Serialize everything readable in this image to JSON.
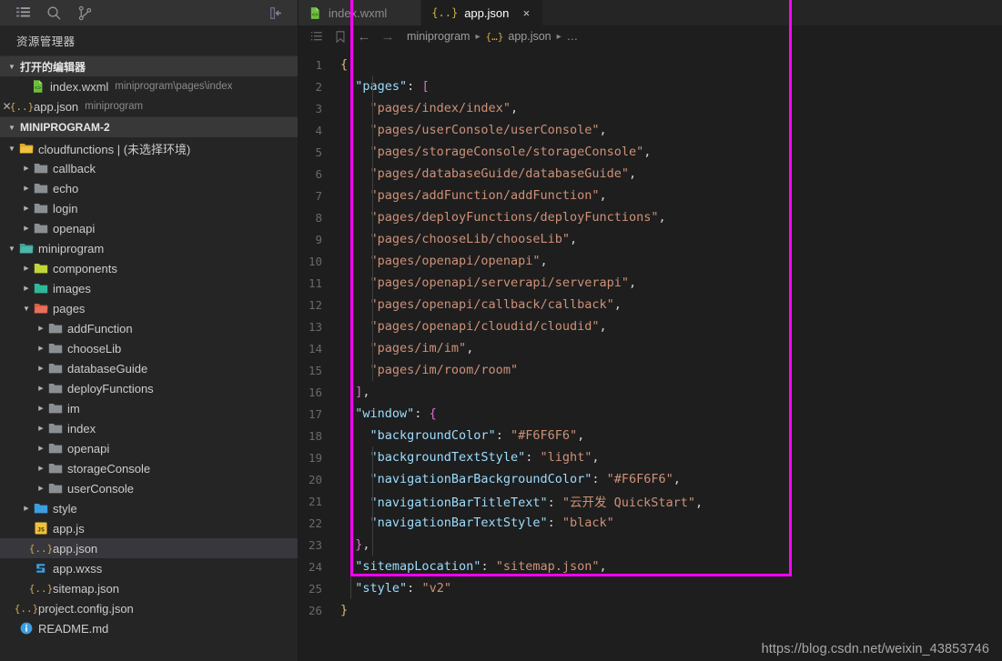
{
  "activity_bar": {
    "icons": [
      "explorer-icon",
      "search-icon",
      "source-control-icon"
    ],
    "collapse_label": "collapse-sidebar-icon"
  },
  "sidebar": {
    "title": "资源管理器",
    "open_editors": {
      "header": "打开的编辑器",
      "items": [
        {
          "name": "index.wxml",
          "desc": "miniprogram\\pages\\index",
          "icon": "wxml-file-icon",
          "selected": false,
          "show_close": false
        },
        {
          "name": "app.json",
          "desc": "miniprogram",
          "icon": "json-file-icon",
          "selected": false,
          "show_close": true
        }
      ]
    },
    "project": {
      "header": "MINIPROGRAM-2",
      "tree": [
        {
          "label": "cloudfunctions | (未选择环境)",
          "depth": 1,
          "type": "folder",
          "state": "open",
          "icon": "folder-yellow-icon",
          "selected": false
        },
        {
          "label": "callback",
          "depth": 2,
          "type": "folder",
          "state": "closed",
          "icon": "folder-gray-icon",
          "selected": false
        },
        {
          "label": "echo",
          "depth": 2,
          "type": "folder",
          "state": "closed",
          "icon": "folder-gray-icon",
          "selected": false
        },
        {
          "label": "login",
          "depth": 2,
          "type": "folder",
          "state": "closed",
          "icon": "folder-gray-icon",
          "selected": false
        },
        {
          "label": "openapi",
          "depth": 2,
          "type": "folder",
          "state": "closed",
          "icon": "folder-gray-icon",
          "selected": false
        },
        {
          "label": "miniprogram",
          "depth": 1,
          "type": "folder",
          "state": "open",
          "icon": "folder-teal-icon",
          "selected": false
        },
        {
          "label": "components",
          "depth": 2,
          "type": "folder",
          "state": "closed",
          "icon": "folder-lime-icon",
          "selected": false
        },
        {
          "label": "images",
          "depth": 2,
          "type": "folder",
          "state": "closed",
          "icon": "folder-green-icon",
          "selected": false
        },
        {
          "label": "pages",
          "depth": 2,
          "type": "folder",
          "state": "open",
          "icon": "folder-red-icon",
          "selected": false
        },
        {
          "label": "addFunction",
          "depth": 3,
          "type": "folder",
          "state": "closed",
          "icon": "folder-gray-icon",
          "selected": false
        },
        {
          "label": "chooseLib",
          "depth": 3,
          "type": "folder",
          "state": "closed",
          "icon": "folder-gray-icon",
          "selected": false
        },
        {
          "label": "databaseGuide",
          "depth": 3,
          "type": "folder",
          "state": "closed",
          "icon": "folder-gray-icon",
          "selected": false
        },
        {
          "label": "deployFunctions",
          "depth": 3,
          "type": "folder",
          "state": "closed",
          "icon": "folder-gray-icon",
          "selected": false
        },
        {
          "label": "im",
          "depth": 3,
          "type": "folder",
          "state": "closed",
          "icon": "folder-gray-icon",
          "selected": false
        },
        {
          "label": "index",
          "depth": 3,
          "type": "folder",
          "state": "closed",
          "icon": "folder-gray-icon",
          "selected": false
        },
        {
          "label": "openapi",
          "depth": 3,
          "type": "folder",
          "state": "closed",
          "icon": "folder-gray-icon",
          "selected": false
        },
        {
          "label": "storageConsole",
          "depth": 3,
          "type": "folder",
          "state": "closed",
          "icon": "folder-gray-icon",
          "selected": false
        },
        {
          "label": "userConsole",
          "depth": 3,
          "type": "folder",
          "state": "closed",
          "icon": "folder-gray-icon",
          "selected": false
        },
        {
          "label": "style",
          "depth": 2,
          "type": "folder",
          "state": "closed",
          "icon": "folder-blue-icon",
          "selected": false
        },
        {
          "label": "app.js",
          "depth": 2,
          "type": "file",
          "state": "none",
          "icon": "js-file-icon",
          "selected": false
        },
        {
          "label": "app.json",
          "depth": 2,
          "type": "file",
          "state": "none",
          "icon": "json-file-icon",
          "selected": true
        },
        {
          "label": "app.wxss",
          "depth": 2,
          "type": "file",
          "state": "none",
          "icon": "wxss-file-icon",
          "selected": false
        },
        {
          "label": "sitemap.json",
          "depth": 2,
          "type": "file",
          "state": "none",
          "icon": "json-file-icon",
          "selected": false
        },
        {
          "label": "project.config.json",
          "depth": 1,
          "type": "file",
          "state": "none",
          "icon": "json-file-icon",
          "selected": false
        },
        {
          "label": "README.md",
          "depth": 1,
          "type": "file",
          "state": "none",
          "icon": "readme-info-icon",
          "selected": false
        }
      ]
    }
  },
  "editor": {
    "tabs": [
      {
        "label": "index.wxml",
        "icon": "wxml-file-icon",
        "active": false,
        "close_label": "×"
      },
      {
        "label": "app.json",
        "icon": "json-file-icon",
        "active": true,
        "close_label": "×"
      }
    ],
    "breadcrumb": {
      "back_arrow": "←",
      "forward_arrow": "→",
      "outline_icon": "outline-icon",
      "bookmark_icon": "bookmark-icon",
      "items": [
        "miniprogram",
        "app.json",
        "…"
      ],
      "json_glyph": "{…}",
      "separator": "▸"
    },
    "lines": [
      {
        "n": "1",
        "tokens": [
          {
            "t": "{",
            "c": "t-br1"
          }
        ],
        "indent": 0
      },
      {
        "n": "2",
        "tokens": [
          {
            "t": "\"pages\"",
            "c": "t-key"
          },
          {
            "t": ": ",
            "c": "t-punc"
          },
          {
            "t": "[",
            "c": "t-br2"
          }
        ],
        "indent": 1
      },
      {
        "n": "3",
        "tokens": [
          {
            "t": "\"pages/index/index\"",
            "c": "t-str"
          },
          {
            "t": ",",
            "c": "t-comma"
          }
        ],
        "indent": 2
      },
      {
        "n": "4",
        "tokens": [
          {
            "t": "\"pages/userConsole/userConsole\"",
            "c": "t-str"
          },
          {
            "t": ",",
            "c": "t-comma"
          }
        ],
        "indent": 2
      },
      {
        "n": "5",
        "tokens": [
          {
            "t": "\"pages/storageConsole/storageConsole\"",
            "c": "t-str"
          },
          {
            "t": ",",
            "c": "t-comma"
          }
        ],
        "indent": 2
      },
      {
        "n": "6",
        "tokens": [
          {
            "t": "\"pages/databaseGuide/databaseGuide\"",
            "c": "t-str"
          },
          {
            "t": ",",
            "c": "t-comma"
          }
        ],
        "indent": 2
      },
      {
        "n": "7",
        "tokens": [
          {
            "t": "\"pages/addFunction/addFunction\"",
            "c": "t-str"
          },
          {
            "t": ",",
            "c": "t-comma"
          }
        ],
        "indent": 2
      },
      {
        "n": "8",
        "tokens": [
          {
            "t": "\"pages/deployFunctions/deployFunctions\"",
            "c": "t-str"
          },
          {
            "t": ",",
            "c": "t-comma"
          }
        ],
        "indent": 2
      },
      {
        "n": "9",
        "tokens": [
          {
            "t": "\"pages/chooseLib/chooseLib\"",
            "c": "t-str"
          },
          {
            "t": ",",
            "c": "t-comma"
          }
        ],
        "indent": 2
      },
      {
        "n": "10",
        "tokens": [
          {
            "t": "\"pages/openapi/openapi\"",
            "c": "t-str"
          },
          {
            "t": ",",
            "c": "t-comma"
          }
        ],
        "indent": 2
      },
      {
        "n": "11",
        "tokens": [
          {
            "t": "\"pages/openapi/serverapi/serverapi\"",
            "c": "t-str"
          },
          {
            "t": ",",
            "c": "t-comma"
          }
        ],
        "indent": 2
      },
      {
        "n": "12",
        "tokens": [
          {
            "t": "\"pages/openapi/callback/callback\"",
            "c": "t-str"
          },
          {
            "t": ",",
            "c": "t-comma"
          }
        ],
        "indent": 2
      },
      {
        "n": "13",
        "tokens": [
          {
            "t": "\"pages/openapi/cloudid/cloudid\"",
            "c": "t-str"
          },
          {
            "t": ",",
            "c": "t-comma"
          }
        ],
        "indent": 2
      },
      {
        "n": "14",
        "tokens": [
          {
            "t": "\"pages/im/im\"",
            "c": "t-str"
          },
          {
            "t": ",",
            "c": "t-comma"
          }
        ],
        "indent": 2
      },
      {
        "n": "15",
        "tokens": [
          {
            "t": "\"pages/im/room/room\"",
            "c": "t-str"
          }
        ],
        "indent": 2
      },
      {
        "n": "16",
        "tokens": [
          {
            "t": "]",
            "c": "t-br2"
          },
          {
            "t": ",",
            "c": "t-comma"
          }
        ],
        "indent": 1
      },
      {
        "n": "17",
        "tokens": [
          {
            "t": "\"window\"",
            "c": "t-key"
          },
          {
            "t": ": ",
            "c": "t-punc"
          },
          {
            "t": "{",
            "c": "t-br2"
          }
        ],
        "indent": 1
      },
      {
        "n": "18",
        "tokens": [
          {
            "t": "\"backgroundColor\"",
            "c": "t-key"
          },
          {
            "t": ": ",
            "c": "t-punc"
          },
          {
            "t": "\"#F6F6F6\"",
            "c": "t-str"
          },
          {
            "t": ",",
            "c": "t-comma"
          }
        ],
        "indent": 2
      },
      {
        "n": "19",
        "tokens": [
          {
            "t": "\"backgroundTextStyle\"",
            "c": "t-key"
          },
          {
            "t": ": ",
            "c": "t-punc"
          },
          {
            "t": "\"light\"",
            "c": "t-str"
          },
          {
            "t": ",",
            "c": "t-comma"
          }
        ],
        "indent": 2
      },
      {
        "n": "20",
        "tokens": [
          {
            "t": "\"navigationBarBackgroundColor\"",
            "c": "t-key"
          },
          {
            "t": ": ",
            "c": "t-punc"
          },
          {
            "t": "\"#F6F6F6\"",
            "c": "t-str"
          },
          {
            "t": ",",
            "c": "t-comma"
          }
        ],
        "indent": 2
      },
      {
        "n": "21",
        "tokens": [
          {
            "t": "\"navigationBarTitleText\"",
            "c": "t-key"
          },
          {
            "t": ": ",
            "c": "t-punc"
          },
          {
            "t": "\"云开发 QuickStart\"",
            "c": "t-str"
          },
          {
            "t": ",",
            "c": "t-comma"
          }
        ],
        "indent": 2
      },
      {
        "n": "22",
        "tokens": [
          {
            "t": "\"navigationBarTextStyle\"",
            "c": "t-key"
          },
          {
            "t": ": ",
            "c": "t-punc"
          },
          {
            "t": "\"black\"",
            "c": "t-str"
          }
        ],
        "indent": 2
      },
      {
        "n": "23",
        "tokens": [
          {
            "t": "}",
            "c": "t-br2"
          },
          {
            "t": ",",
            "c": "t-comma"
          }
        ],
        "indent": 1
      },
      {
        "n": "24",
        "tokens": [
          {
            "t": "\"sitemapLocation\"",
            "c": "t-key"
          },
          {
            "t": ": ",
            "c": "t-punc"
          },
          {
            "t": "\"sitemap.json\"",
            "c": "t-str"
          },
          {
            "t": ",",
            "c": "t-comma"
          }
        ],
        "indent": 1
      },
      {
        "n": "25",
        "tokens": [
          {
            "t": "\"style\"",
            "c": "t-key"
          },
          {
            "t": ": ",
            "c": "t-punc"
          },
          {
            "t": "\"v2\"",
            "c": "t-str"
          }
        ],
        "indent": 1
      },
      {
        "n": "26",
        "tokens": [
          {
            "t": "}",
            "c": "t-br1"
          }
        ],
        "indent": 0
      }
    ]
  },
  "annotation": {
    "color": "#ff00ff",
    "shape": "rectangle"
  },
  "watermark": {
    "text": "https://blog.csdn.net/weixin_43853746"
  },
  "colors": {
    "editor_bg": "#1e1e1e",
    "sidebar_bg": "#252526",
    "activity_bg": "#333333",
    "selection_bg": "#37373d",
    "string": "#ce9178",
    "key": "#9cdcfe",
    "bracket_yellow": "#d7ba7d",
    "bracket_magenta": "#da70d6",
    "accent": "#ff00ff"
  }
}
